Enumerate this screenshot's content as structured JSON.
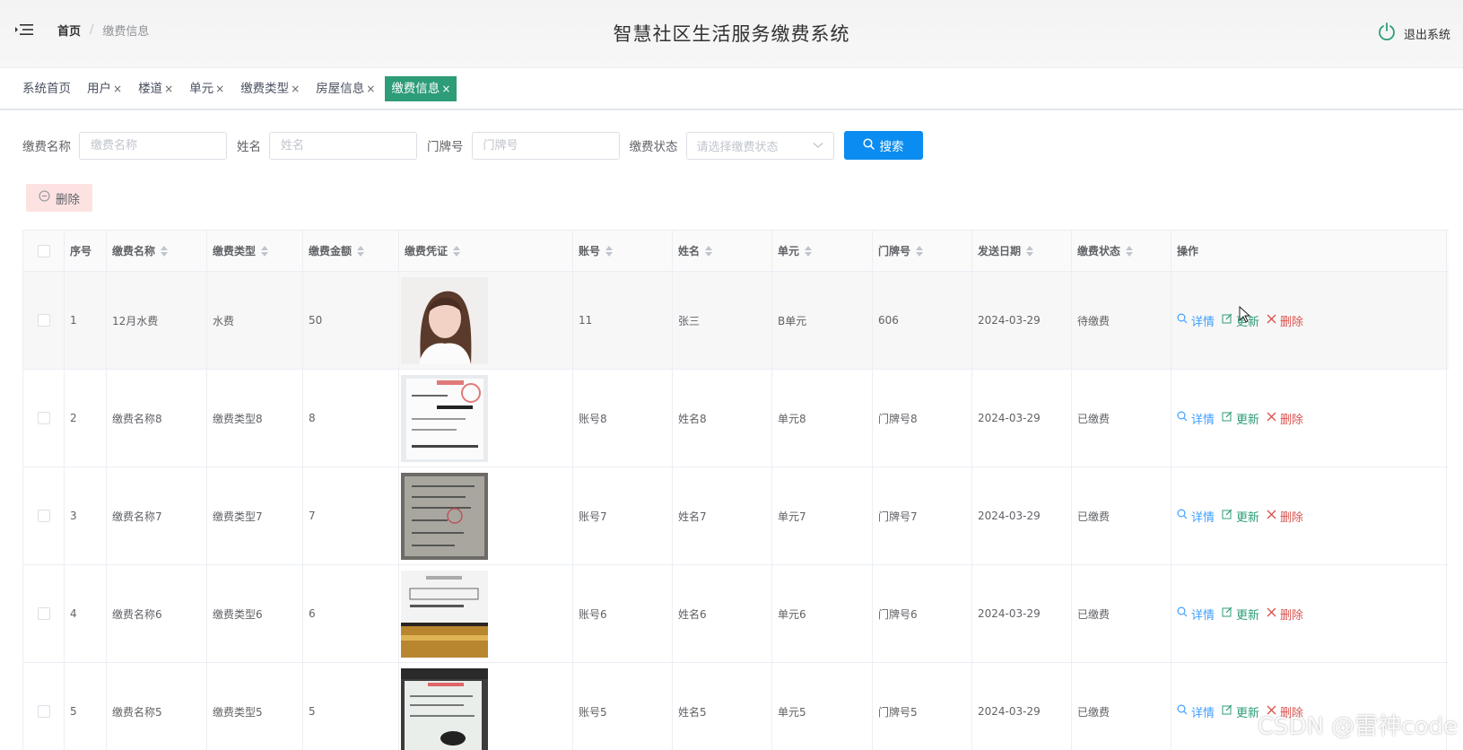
{
  "header": {
    "breadcrumb_home": "首页",
    "breadcrumb_sep": "/",
    "breadcrumb_current": "缴费信息",
    "title": "智慧社区生活服务缴费系统",
    "logout_label": "退出系统"
  },
  "tabs": [
    {
      "label": "系统首页",
      "closable": false
    },
    {
      "label": "用户",
      "closable": true
    },
    {
      "label": "楼道",
      "closable": true
    },
    {
      "label": "单元",
      "closable": true
    },
    {
      "label": "缴费类型",
      "closable": true
    },
    {
      "label": "房屋信息",
      "closable": true
    },
    {
      "label": "缴费信息",
      "closable": true,
      "active": true
    }
  ],
  "tab_close_glyph": "×",
  "search": {
    "fee_name_label": "缴费名称",
    "fee_name_placeholder": "缴费名称",
    "name_label": "姓名",
    "name_placeholder": "姓名",
    "door_label": "门牌号",
    "door_placeholder": "门牌号",
    "status_label": "缴费状态",
    "status_placeholder": "请选择缴费状态",
    "button_label": "搜索"
  },
  "delete_button_label": "删除",
  "table": {
    "columns": [
      "序号",
      "缴费名称",
      "缴费类型",
      "缴费金额",
      "缴费凭证",
      "账号",
      "姓名",
      "单元",
      "门牌号",
      "发送日期",
      "缴费状态",
      "操作"
    ],
    "rows": [
      {
        "index": "1",
        "fee_name": "12月水费",
        "fee_type": "水费",
        "amount": "50",
        "account": "11",
        "name": "张三",
        "unit": "B单元",
        "door": "606",
        "date": "2024-03-29",
        "status": "待缴费",
        "image": "portrait-photo"
      },
      {
        "index": "2",
        "fee_name": "缴费名称8",
        "fee_type": "缴费类型8",
        "amount": "8",
        "account": "账号8",
        "name": "姓名8",
        "unit": "单元8",
        "door": "门牌号8",
        "date": "2024-03-29",
        "status": "已缴费",
        "image": "receipt-photo"
      },
      {
        "index": "3",
        "fee_name": "缴费名称7",
        "fee_type": "缴费类型7",
        "amount": "7",
        "account": "账号7",
        "name": "姓名7",
        "unit": "单元7",
        "door": "门牌号7",
        "date": "2024-03-29",
        "status": "已缴费",
        "image": "document-photo"
      },
      {
        "index": "4",
        "fee_name": "缴费名称6",
        "fee_type": "缴费类型6",
        "amount": "6",
        "account": "账号6",
        "name": "姓名6",
        "unit": "单元6",
        "door": "门牌号6",
        "date": "2024-03-29",
        "status": "已缴费",
        "image": "invoice-photo"
      },
      {
        "index": "5",
        "fee_name": "缴费名称5",
        "fee_type": "缴费类型5",
        "amount": "5",
        "account": "账号5",
        "name": "姓名5",
        "unit": "单元5",
        "door": "门牌号5",
        "date": "2024-03-29",
        "status": "已缴费",
        "image": "form-photo"
      }
    ],
    "actions": {
      "detail": "详情",
      "update": "更新",
      "delete": "删除"
    }
  },
  "watermark": "CSDN @雷神code",
  "colors": {
    "accent": "#2d9c78",
    "primary": "#0a8cf0",
    "danger": "#d9534f",
    "link": "#409eff"
  }
}
